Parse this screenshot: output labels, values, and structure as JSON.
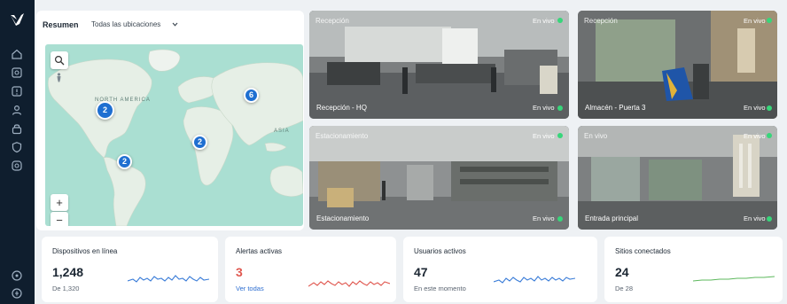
{
  "overview": {
    "title": "Resumen",
    "location_select": "Todas las ubicaciones",
    "clusters": [
      "2",
      "2",
      "2",
      "6"
    ],
    "map_labels": [
      "NORTH AMERICA",
      "ASIA"
    ],
    "zoom_in": "+",
    "zoom_out": "−"
  },
  "cameras": [
    {
      "top_label": "Recepción",
      "name": "Recepción - HQ",
      "status_top": "En vivo",
      "status_bottom": "En vivo"
    },
    {
      "top_label": "Recepción",
      "name": "Almacén - Puerta 3",
      "status_top": "En vivo",
      "status_bottom": "En vivo"
    },
    {
      "top_label": "Estacionamiento",
      "name": "Estacionamiento",
      "status_top": "En vivo",
      "status_bottom": "En vivo"
    },
    {
      "top_label": "En vivo",
      "name": "Entrada principal",
      "status_top": "En vivo",
      "status_bottom": "En vivo"
    }
  ],
  "stats": [
    {
      "title": "Dispositivos en línea",
      "value": "1,248",
      "sub": "De 1,320",
      "color": "#3b7dd8"
    },
    {
      "title": "Alertas activas",
      "value": "3",
      "sub": "Ver todas",
      "color": "#e0574f"
    },
    {
      "title": "Usuarios activos",
      "value": "47",
      "sub": "En este momento",
      "color": "#3b7dd8"
    },
    {
      "title": "Sitios conectados",
      "value": "24",
      "sub": "De 28",
      "color": "#5cb85c"
    }
  ],
  "colors": {
    "sidebar": "#0f1e2e",
    "accent": "#1f6fd1",
    "live": "#37d67a",
    "alert": "#e0574f"
  },
  "icons": [
    "logo-icon",
    "home-icon",
    "camera-icon",
    "alert-icon",
    "users-icon",
    "lock-icon",
    "shield-icon",
    "settings-icon",
    "help-icon",
    "logout-icon"
  ]
}
